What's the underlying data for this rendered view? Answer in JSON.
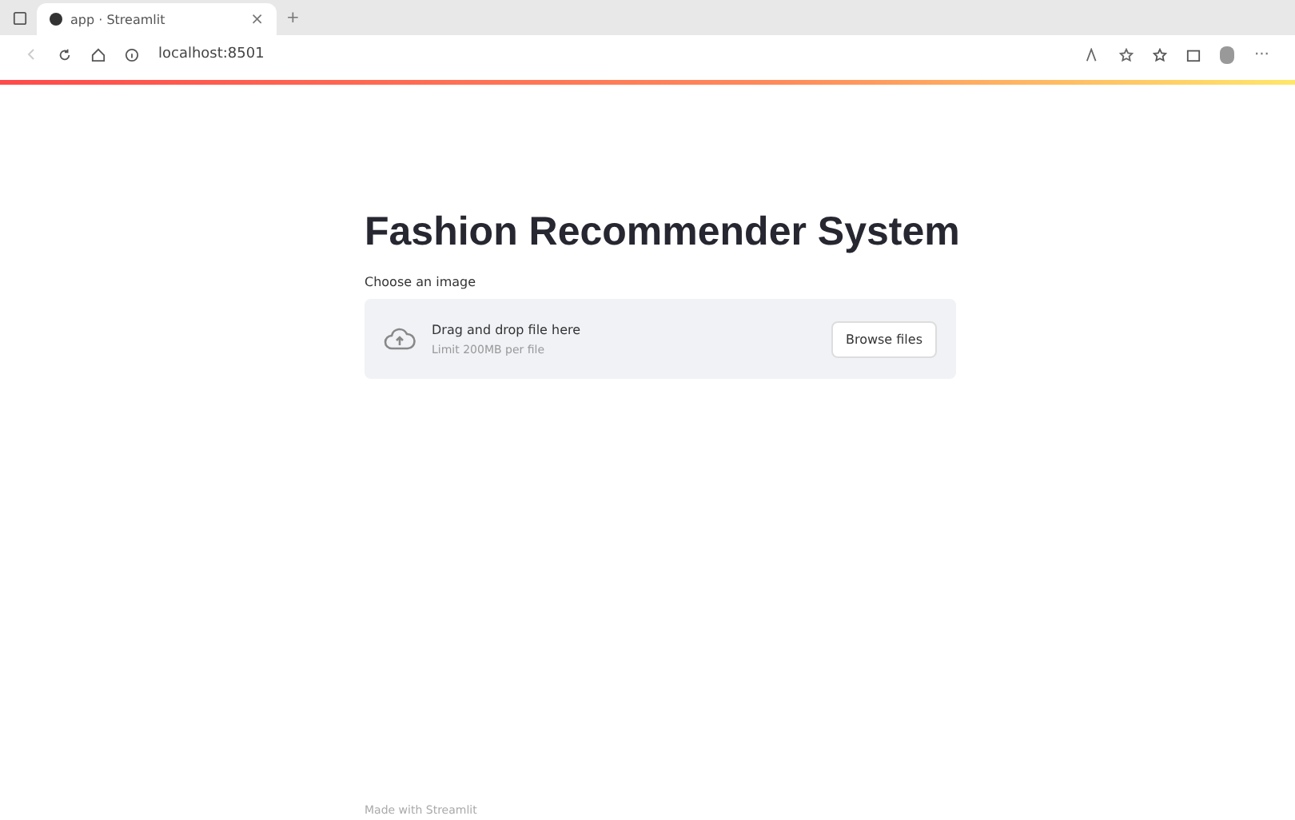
{
  "browser": {
    "tab_title": "app · Streamlit",
    "tab_close": "×",
    "new_tab": "+",
    "address": "localhost:8501",
    "more": "···"
  },
  "page": {
    "title": "Fashion Recommender System",
    "uploader": {
      "label": "Choose an image",
      "prompt": "Drag and drop file here",
      "limit": "Limit 200MB per file",
      "button": "Browse files"
    },
    "footer": "Made with Streamlit"
  }
}
